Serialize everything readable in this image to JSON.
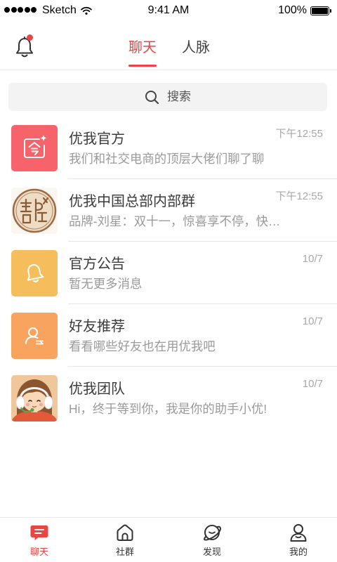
{
  "status_bar": {
    "signal_strength": 5,
    "carrier": "Sketch",
    "time": "9:41 AM",
    "battery": "100%",
    "battery_level": 1.0
  },
  "header": {
    "bell_icon": "bell-icon",
    "has_unread_dot": true,
    "tabs": [
      {
        "label": "聊天",
        "active": true
      },
      {
        "label": "人脉",
        "active": false
      }
    ]
  },
  "search": {
    "icon": "search-icon",
    "label": "搜索"
  },
  "chats": [
    {
      "title": "优我官方",
      "preview": "我们和社交电商的顶层大佬们聊了聊",
      "time": "下午12:55",
      "avatar": "coupon-icon",
      "avatar_color": "#F6636A"
    },
    {
      "title": "优我中国总部内部群",
      "preview": "品牌-刘星：双十一，惊喜享不停，快…",
      "time": "下午12:55",
      "avatar": "group-seal-image",
      "avatar_color": "#FBF6EF"
    },
    {
      "title": "官方公告",
      "preview": "暂无更多消息",
      "time": "10/7",
      "avatar": "bell-icon",
      "avatar_color": "#F5BD5B"
    },
    {
      "title": "好友推荐",
      "preview": "看看哪些好友也在用优我吧",
      "time": "10/7",
      "avatar": "friend-icon",
      "avatar_color": "#F8A45F"
    },
    {
      "title": "优我团队",
      "preview": "Hi，终于等到你，我是你的助手小优!",
      "time": "10/7",
      "avatar": "assistant-girl-image",
      "avatar_color": "#EFC79A"
    }
  ],
  "tab_bar": {
    "items": [
      {
        "label": "聊天",
        "icon": "chat-bubble-icon",
        "active": true
      },
      {
        "label": "社群",
        "icon": "house-icon",
        "active": false
      },
      {
        "label": "发现",
        "icon": "planet-icon",
        "active": false
      },
      {
        "label": "我的",
        "icon": "person-icon",
        "active": false
      }
    ]
  },
  "colors": {
    "accent": "#EA4443"
  }
}
